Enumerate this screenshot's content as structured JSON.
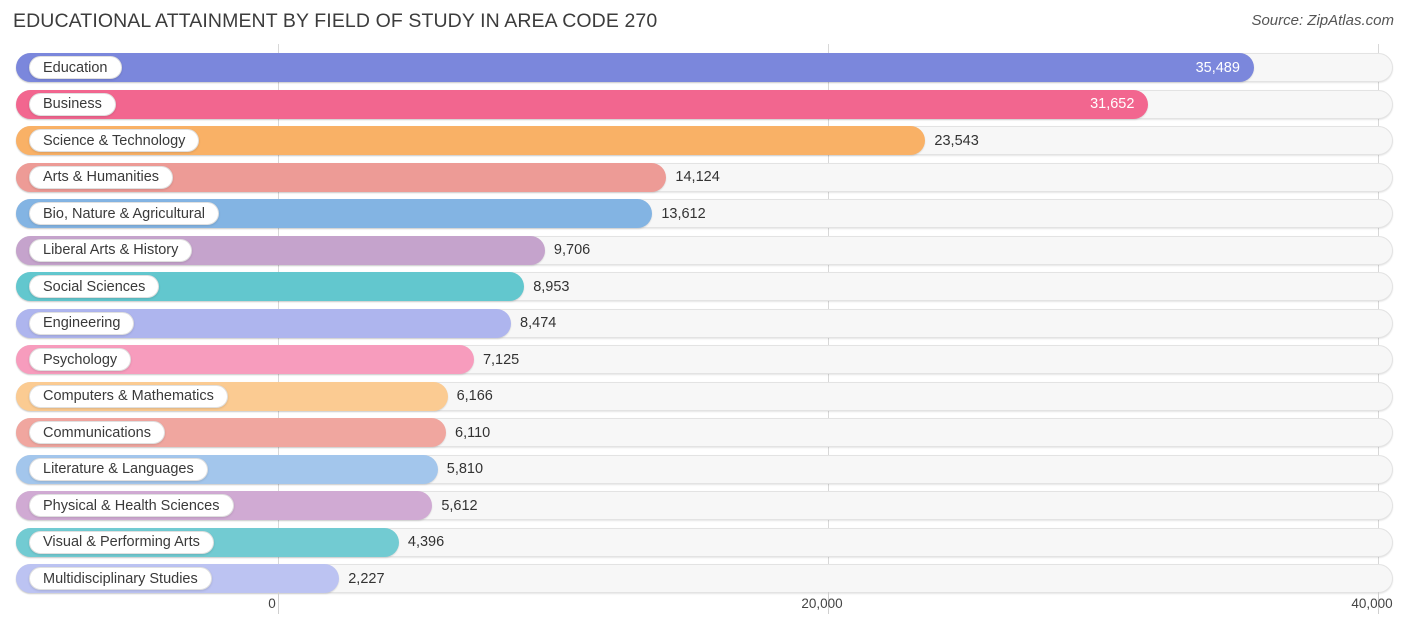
{
  "header": {
    "title": "EDUCATIONAL ATTAINMENT BY FIELD OF STUDY IN AREA CODE 270",
    "source": "Source: ZipAtlas.com"
  },
  "chart_data": {
    "type": "bar",
    "orientation": "horizontal",
    "title": "EDUCATIONAL ATTAINMENT BY FIELD OF STUDY IN AREA CODE 270",
    "xlabel": "",
    "ylabel": "",
    "xlim": [
      0,
      40600
    ],
    "grid": true,
    "legend": "none",
    "xticks": [
      0,
      20000,
      40000
    ],
    "xticklabels": [
      "0",
      "20,000",
      "40,000"
    ],
    "categories": [
      "Education",
      "Business",
      "Science & Technology",
      "Arts & Humanities",
      "Bio, Nature & Agricultural",
      "Liberal Arts & History",
      "Social Sciences",
      "Engineering",
      "Psychology",
      "Computers & Mathematics",
      "Communications",
      "Literature & Languages",
      "Physical & Health Sciences",
      "Visual & Performing Arts",
      "Multidisciplinary Studies"
    ],
    "values": [
      35489,
      31652,
      23543,
      14124,
      13612,
      9706,
      8953,
      8474,
      7125,
      6166,
      6110,
      5810,
      5612,
      4396,
      2227
    ],
    "value_labels": [
      "35,489",
      "31,652",
      "23,543",
      "14,124",
      "13,612",
      "9,706",
      "8,953",
      "8,474",
      "7,125",
      "6,166",
      "6,110",
      "5,810",
      "5,612",
      "4,396",
      "2,227"
    ],
    "label_placement": [
      "inside",
      "inside",
      "outside",
      "outside",
      "outside",
      "outside",
      "outside",
      "outside",
      "outside",
      "outside",
      "outside",
      "outside",
      "outside",
      "outside",
      "outside"
    ],
    "colors": [
      "#7b87dc",
      "#f2668f",
      "#f9b166",
      "#ed9b96",
      "#83b4e3",
      "#c5a3cc",
      "#62c7ce",
      "#aeb5ee",
      "#f79cbd",
      "#fbcb92",
      "#f0a69f",
      "#a3c6ec",
      "#d0aad3",
      "#72cbd2",
      "#bcc3f2"
    ]
  }
}
